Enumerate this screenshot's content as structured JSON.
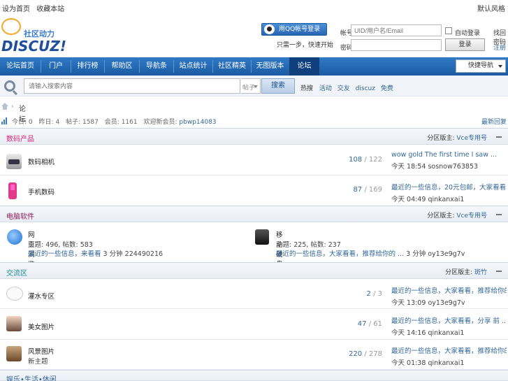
{
  "topbar": {
    "left_items": [
      "设为首页",
      "收藏本站"
    ],
    "right": "默认风格"
  },
  "logo": {
    "tagline": "社区动力",
    "word": "DISCUZ!"
  },
  "qq_login": {
    "button": "用QQ帐号登录",
    "sub": "只需一步，快速开始"
  },
  "login": {
    "user_label": "帐号",
    "user_placeholder": "UID/用户名/Email",
    "pass_label": "密码",
    "remember": "自动登录",
    "submit": "登录",
    "register": "找回密码",
    "register2": "注册"
  },
  "nav": {
    "items": [
      {
        "label": "论坛首页",
        "active": false
      },
      {
        "label": "门户",
        "active": false
      },
      {
        "label": "排行榜",
        "active": false
      },
      {
        "label": "帮助区",
        "active": false
      },
      {
        "label": "导航条",
        "active": false
      },
      {
        "label": "站点统计",
        "active": false
      },
      {
        "label": "社区精英",
        "active": false
      },
      {
        "label": "无图版本",
        "active": false
      },
      {
        "label": "论坛",
        "active": true
      }
    ],
    "select": "快捷导航"
  },
  "search": {
    "placeholder": "请输入搜索内容",
    "type": "帖子",
    "button": "搜索",
    "hot_label": "热搜",
    "hot": [
      "活动",
      "交友",
      "discuz",
      "免费"
    ]
  },
  "breadcrumb": {
    "current": "论坛"
  },
  "stats": {
    "today_label": "今日",
    "today": "0",
    "yesterday_label": "昨日",
    "yesterday": "4",
    "threads_label": "帖子",
    "threads": "1587",
    "members_label": "会员",
    "members": "1161",
    "newest_label": "欢迎新会员",
    "newest": "pbwp14083",
    "right": "最新回复"
  },
  "categories": [
    {
      "title": "数码产品",
      "title_color": "#d4247a",
      "mod_label": "分区版主",
      "mod": "Vce专用号",
      "forums": [
        {
          "name": "数码相机",
          "icon": "camera-icon",
          "threads": "108",
          "posts": "122",
          "last_title": "wow gold The first time I saw ...",
          "last_time": "今天 18:54",
          "last_user": "sosnow763853"
        },
        {
          "name": "手机数码",
          "icon": "phone-icon",
          "threads": "87",
          "posts": "169",
          "last_title": "最近的一些信息，20元包邮，大家看看 ...",
          "last_time": "今天 04:49",
          "last_user": "qinkanxai1"
        }
      ]
    },
    {
      "title": "电脑软件",
      "title_color": "#8b1a5a",
      "mod_label": "分区版主",
      "mod": "Vce专用号",
      "forums": [
        {
          "name": "网页浏览",
          "icon": "browser-icon",
          "topics_label": "主题",
          "topics": "496",
          "posts_label": "帖数",
          "posts": "583",
          "last_title": "最近的一些信息，来看看",
          "last_extra": "3 分钟",
          "last_user": "224490216"
        },
        {
          "name": "移动硬盘",
          "icon": "drive-icon",
          "topics_label": "主题",
          "topics": "225",
          "posts_label": "帖数",
          "posts": "237",
          "last_title": "最近的一些信息，大家看看，推荐给你的 ...",
          "last_extra": "3 分钟",
          "last_user": "oy13e9g7v"
        }
      ]
    },
    {
      "title": "交流区",
      "title_color": "#1a8a9a",
      "mod_label": "分区版主",
      "mod": "斑竹",
      "forums": [
        {
          "name": "灌水专区",
          "icon": "bubble-icon",
          "sub": "",
          "threads": "2",
          "posts": "3",
          "last_title": "最近的一些信息，大家看看，推荐给你的 ...",
          "last_time": "今天 13:09",
          "last_user": "oy13e9g7v"
        },
        {
          "name": "美女图片",
          "icon": "girl-icon",
          "sub": "",
          "threads": "47",
          "posts": "61",
          "last_title": "最近的一些信息，大家看看，分享 前 ...",
          "last_time": "今天 14:16",
          "last_user": "qinkanxai1"
        },
        {
          "name": "风景图片",
          "icon": "house-icon",
          "sub": "新主题",
          "threads": "220",
          "posts": "278",
          "last_title": "最近的一些信息，大家看看，推荐给你的 ...",
          "last_time": "今天 01:38",
          "last_user": "qinkanxai1"
        }
      ]
    }
  ],
  "bottom_cat": {
    "title": "娱乐•生活•休闲"
  }
}
